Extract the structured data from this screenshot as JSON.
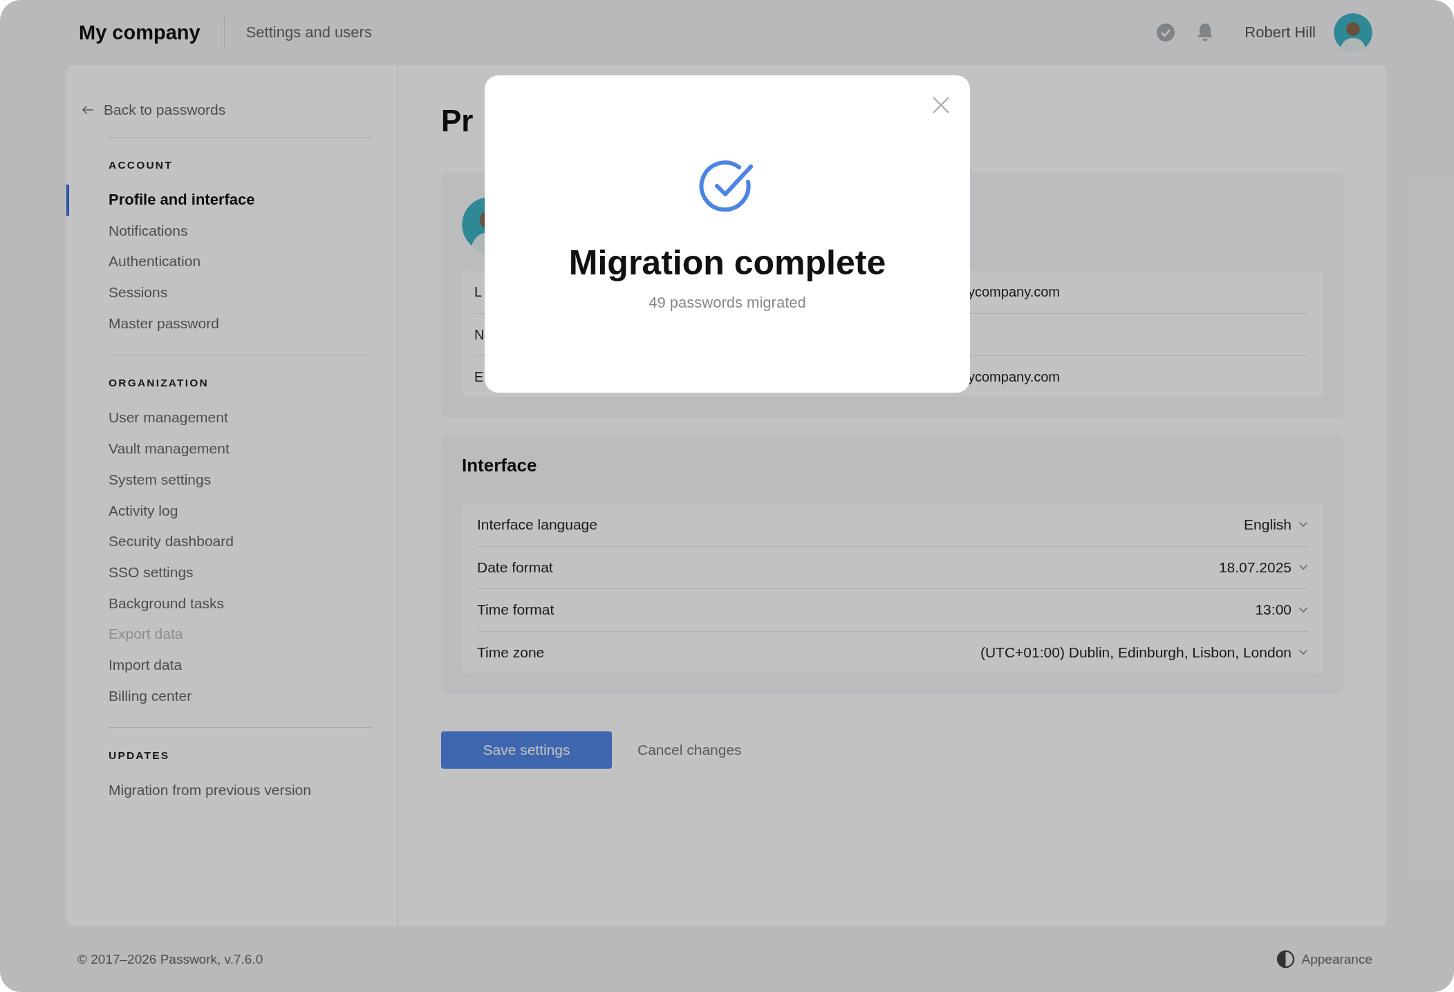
{
  "topbar": {
    "brand": "My company",
    "section": "Settings and users",
    "user_name": "Robert Hill"
  },
  "sidebar": {
    "back_link": "Back to passwords",
    "groups": [
      {
        "heading": "ACCOUNT",
        "items": [
          {
            "label": "Profile and interface",
            "selected": true,
            "disabled": false
          },
          {
            "label": "Notifications",
            "selected": false,
            "disabled": false
          },
          {
            "label": "Authentication",
            "selected": false,
            "disabled": false
          },
          {
            "label": "Sessions",
            "selected": false,
            "disabled": false
          },
          {
            "label": "Master password",
            "selected": false,
            "disabled": false
          }
        ]
      },
      {
        "heading": "ORGANIZATION",
        "items": [
          {
            "label": "User management",
            "selected": false,
            "disabled": false
          },
          {
            "label": "Vault management",
            "selected": false,
            "disabled": false
          },
          {
            "label": "System settings",
            "selected": false,
            "disabled": false
          },
          {
            "label": "Activity log",
            "selected": false,
            "disabled": false
          },
          {
            "label": "Security dashboard",
            "selected": false,
            "disabled": false
          },
          {
            "label": "SSO settings",
            "selected": false,
            "disabled": false
          },
          {
            "label": "Background tasks",
            "selected": false,
            "disabled": false
          },
          {
            "label": "Export data",
            "selected": false,
            "disabled": true
          },
          {
            "label": "Import data",
            "selected": false,
            "disabled": false
          },
          {
            "label": "Billing center",
            "selected": false,
            "disabled": false
          }
        ]
      },
      {
        "heading": "UPDATES",
        "items": [
          {
            "label": "Migration from previous version",
            "selected": false,
            "disabled": false
          }
        ]
      }
    ]
  },
  "page": {
    "title": "Pr"
  },
  "profile": {
    "fields": [
      {
        "label": "L",
        "value": "ycompany.com"
      },
      {
        "label": "N"
      },
      {
        "label": "E",
        "value": "ycompany.com"
      }
    ]
  },
  "interface": {
    "heading": "Interface",
    "settings": [
      {
        "label": "Interface language",
        "value": "English"
      },
      {
        "label": "Date format",
        "value": "18.07.2025"
      },
      {
        "label": "Time format",
        "value": "13:00"
      },
      {
        "label": "Time zone",
        "value": "(UTC+01:00) Dublin, Edinburgh, Lisbon, London"
      }
    ]
  },
  "actions": {
    "save": "Save settings",
    "cancel": "Cancel changes"
  },
  "footer": {
    "copyright": "© 2017–2026 Passwork, v.7.6.0",
    "appearance": "Appearance"
  },
  "dialog": {
    "title": "Migration complete",
    "message": "49 passwords migrated"
  }
}
